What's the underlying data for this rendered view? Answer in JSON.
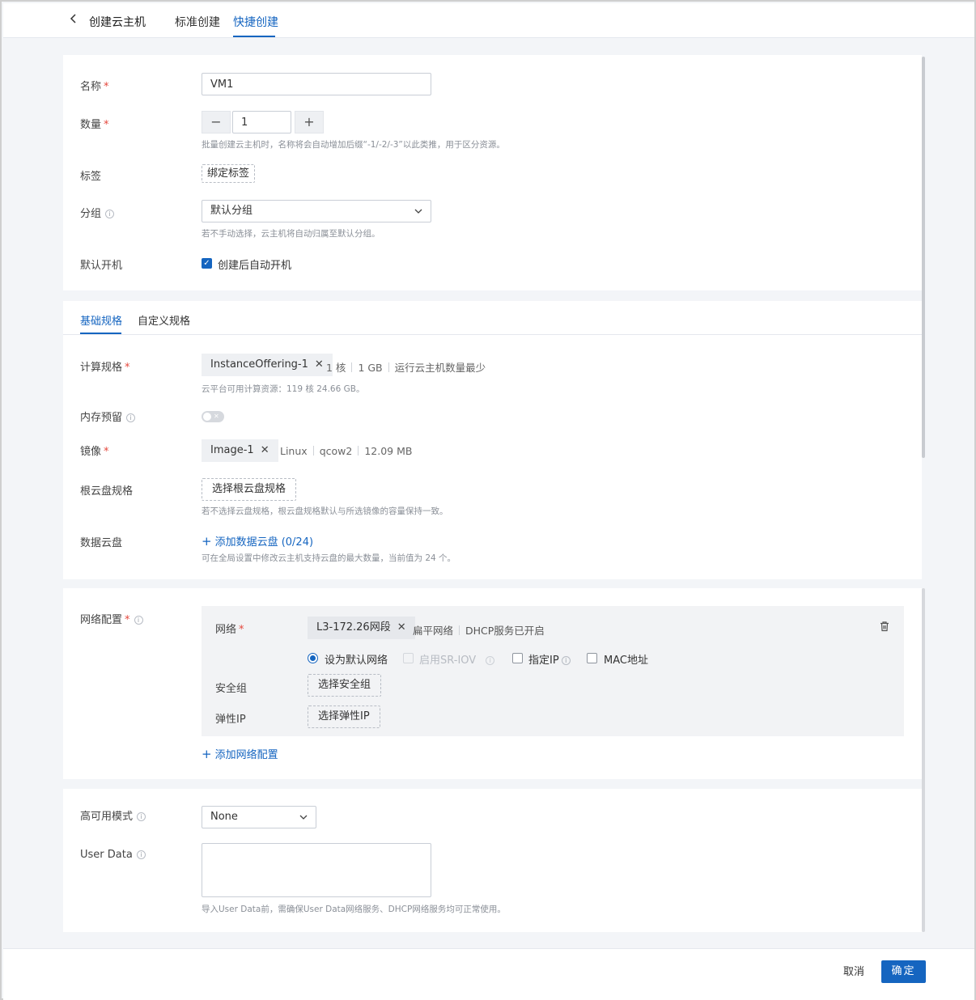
{
  "header": {
    "back_icon": "chevron-left-icon",
    "title": "创建云主机",
    "tabs": [
      {
        "label": "标准创建",
        "active": false
      },
      {
        "label": "快捷创建",
        "active": true
      }
    ]
  },
  "basic": {
    "name_label": "名称",
    "name_value": "VM1",
    "quantity_label": "数量",
    "quantity_value": "1",
    "quantity_minus": "−",
    "quantity_plus": "+",
    "quantity_hint": "批量创建云主机时，名称将会自动增加后缀“-1/-2/-3”以此类推，用于区分资源。",
    "tags_label": "标签",
    "bind_tag_button": "绑定标签",
    "group_label": "分组",
    "group_value": "默认分组",
    "group_hint": "若不手动选择，云主机将自动归属至默认分组。",
    "autostart_label": "默认开机",
    "autostart_checkbox_label": "创建后自动开机",
    "autostart_checked": true
  },
  "spec": {
    "tabs": [
      {
        "label": "基础规格",
        "active": true
      },
      {
        "label": "自定义规格",
        "active": false
      }
    ],
    "compute_label": "计算规格",
    "compute_value": "InstanceOffering-1",
    "compute_meta": [
      "1 核",
      "1 GB",
      "运行云主机数量最少"
    ],
    "compute_hint": "云平台可用计算资源：119 核 24.66 GB。",
    "memory_reserve_label": "内存预留",
    "memory_reserve_on": false,
    "image_label": "镜像",
    "image_value": "Image-1",
    "image_meta": [
      "Linux",
      "qcow2",
      "12.09 MB"
    ],
    "root_disk_label": "根云盘规格",
    "root_disk_button": "选择根云盘规格",
    "root_disk_hint": "若不选择云盘规格，根云盘规格默认与所选镜像的容量保持一致。",
    "data_disk_label": "数据云盘",
    "data_disk_link": "添加数据云盘 (0/24)",
    "data_disk_hint": "可在全局设置中修改云主机支持云盘的最大数量，当前值为 24 个。"
  },
  "network": {
    "section_label": "网络配置",
    "net_label": "网络",
    "net_value": "L3-172.26网段",
    "net_meta": [
      "扁平网络",
      "DHCP服务已开启"
    ],
    "default_net_label": "设为默认网络",
    "sriov_label": "启用SR-IOV",
    "fixed_ip_label": "指定IP",
    "mac_label": "MAC地址",
    "security_group_label": "安全组",
    "security_group_button": "选择安全组",
    "eip_label": "弹性IP",
    "eip_button": "选择弹性IP",
    "add_network_link": "添加网络配置",
    "delete_icon": "trash-icon"
  },
  "advanced": {
    "ha_label": "高可用模式",
    "ha_value": "None",
    "userdata_label": "User Data",
    "userdata_value": "",
    "userdata_hint": "导入User Data前，需确保User Data网络服务、DHCP网络服务均可正常使用。"
  },
  "footer": {
    "cancel_label": "取消",
    "ok_label": "确定"
  },
  "colors": {
    "accent": "#1565c0",
    "required": "#e5483d"
  }
}
